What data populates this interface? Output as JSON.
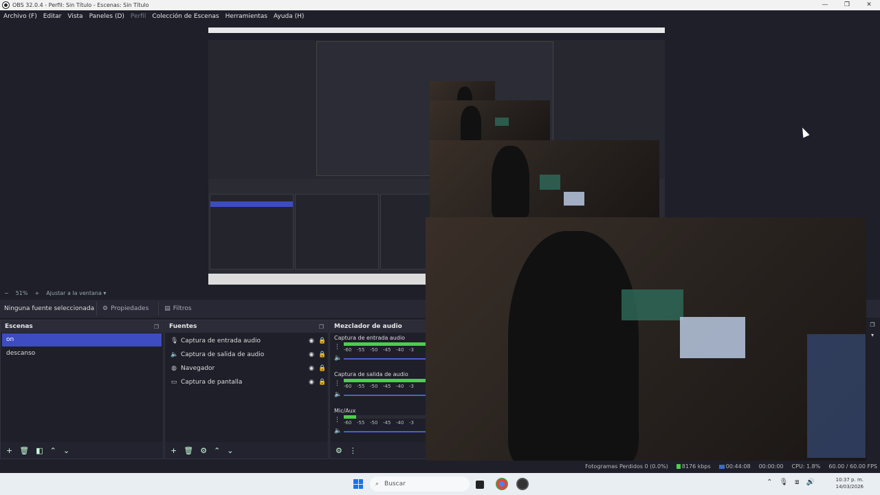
{
  "window": {
    "title": "OBS 32.0.4 - Perfil: Sin Título - Escenas: Sin Título",
    "controls": {
      "minimize": "—",
      "maximize": "❐",
      "close": "✕"
    }
  },
  "menu": {
    "items": [
      "Archivo (F)",
      "Editar",
      "Vista",
      "Paneles (D)",
      "Perfil",
      "Colección de Escenas",
      "Herramientas",
      "Ayuda (H)"
    ]
  },
  "zoom": {
    "minus": "−",
    "value": "51%",
    "plus": "+",
    "fit_label": "Ajustar a la ventana"
  },
  "context": {
    "no_source": "Ninguna fuente seleccionada",
    "properties_label": "Propiedades",
    "filters_label": "Filtros"
  },
  "scenes": {
    "title": "Escenas",
    "items": [
      "on",
      "descanso"
    ],
    "active_index": 0
  },
  "sources": {
    "title": "Fuentes",
    "items": [
      {
        "label": "Captura de entrada audio",
        "icon": "microphone-icon"
      },
      {
        "label": "Captura de salida de audio",
        "icon": "speaker-icon"
      },
      {
        "label": "Navegador",
        "icon": "globe-icon"
      },
      {
        "label": "Captura de pantalla",
        "icon": "monitor-icon"
      }
    ]
  },
  "mixer": {
    "title": "Mezclador de audio",
    "channels": [
      {
        "name": "Captura de entrada audio",
        "level": 1.0
      },
      {
        "name": "Captura de salida de audio",
        "level": 1.0
      },
      {
        "name": "Mic/Aux",
        "level": 0.15
      }
    ],
    "ticks": [
      "-60",
      "-55",
      "-50",
      "-45",
      "-40",
      "-3"
    ]
  },
  "status": {
    "dropped": "Fotogramas Perdidos 0 (0.0%)",
    "bitrate": "8176 kbps",
    "stream_time": "00:44:08",
    "rec_time": "00:00:00",
    "cpu": "CPU: 1.8%",
    "fps": "60.00 / 60.00 FPS"
  },
  "taskbar": {
    "search_placeholder": "Buscar",
    "time": "10:37 p. m.",
    "date": "14/03/2026"
  },
  "colors": {
    "accent": "#3d4cc0",
    "background": "#1e1f29",
    "meter_green": "#4ad04a"
  }
}
